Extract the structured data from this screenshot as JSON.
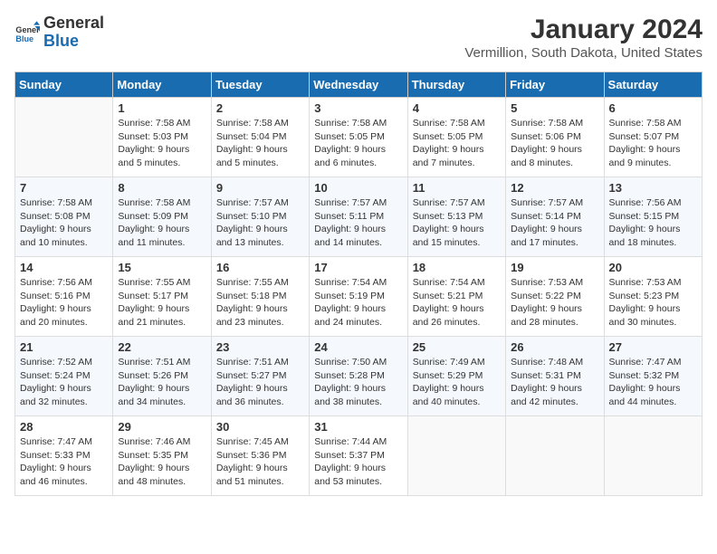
{
  "logo": {
    "general": "General",
    "blue": "Blue"
  },
  "title": "January 2024",
  "location": "Vermillion, South Dakota, United States",
  "days_of_week": [
    "Sunday",
    "Monday",
    "Tuesday",
    "Wednesday",
    "Thursday",
    "Friday",
    "Saturday"
  ],
  "weeks": [
    [
      {
        "day": "",
        "info": ""
      },
      {
        "day": "1",
        "info": "Sunrise: 7:58 AM\nSunset: 5:03 PM\nDaylight: 9 hours\nand 5 minutes."
      },
      {
        "day": "2",
        "info": "Sunrise: 7:58 AM\nSunset: 5:04 PM\nDaylight: 9 hours\nand 5 minutes."
      },
      {
        "day": "3",
        "info": "Sunrise: 7:58 AM\nSunset: 5:05 PM\nDaylight: 9 hours\nand 6 minutes."
      },
      {
        "day": "4",
        "info": "Sunrise: 7:58 AM\nSunset: 5:05 PM\nDaylight: 9 hours\nand 7 minutes."
      },
      {
        "day": "5",
        "info": "Sunrise: 7:58 AM\nSunset: 5:06 PM\nDaylight: 9 hours\nand 8 minutes."
      },
      {
        "day": "6",
        "info": "Sunrise: 7:58 AM\nSunset: 5:07 PM\nDaylight: 9 hours\nand 9 minutes."
      }
    ],
    [
      {
        "day": "7",
        "info": "Sunrise: 7:58 AM\nSunset: 5:08 PM\nDaylight: 9 hours\nand 10 minutes."
      },
      {
        "day": "8",
        "info": "Sunrise: 7:58 AM\nSunset: 5:09 PM\nDaylight: 9 hours\nand 11 minutes."
      },
      {
        "day": "9",
        "info": "Sunrise: 7:57 AM\nSunset: 5:10 PM\nDaylight: 9 hours\nand 13 minutes."
      },
      {
        "day": "10",
        "info": "Sunrise: 7:57 AM\nSunset: 5:11 PM\nDaylight: 9 hours\nand 14 minutes."
      },
      {
        "day": "11",
        "info": "Sunrise: 7:57 AM\nSunset: 5:13 PM\nDaylight: 9 hours\nand 15 minutes."
      },
      {
        "day": "12",
        "info": "Sunrise: 7:57 AM\nSunset: 5:14 PM\nDaylight: 9 hours\nand 17 minutes."
      },
      {
        "day": "13",
        "info": "Sunrise: 7:56 AM\nSunset: 5:15 PM\nDaylight: 9 hours\nand 18 minutes."
      }
    ],
    [
      {
        "day": "14",
        "info": "Sunrise: 7:56 AM\nSunset: 5:16 PM\nDaylight: 9 hours\nand 20 minutes."
      },
      {
        "day": "15",
        "info": "Sunrise: 7:55 AM\nSunset: 5:17 PM\nDaylight: 9 hours\nand 21 minutes."
      },
      {
        "day": "16",
        "info": "Sunrise: 7:55 AM\nSunset: 5:18 PM\nDaylight: 9 hours\nand 23 minutes."
      },
      {
        "day": "17",
        "info": "Sunrise: 7:54 AM\nSunset: 5:19 PM\nDaylight: 9 hours\nand 24 minutes."
      },
      {
        "day": "18",
        "info": "Sunrise: 7:54 AM\nSunset: 5:21 PM\nDaylight: 9 hours\nand 26 minutes."
      },
      {
        "day": "19",
        "info": "Sunrise: 7:53 AM\nSunset: 5:22 PM\nDaylight: 9 hours\nand 28 minutes."
      },
      {
        "day": "20",
        "info": "Sunrise: 7:53 AM\nSunset: 5:23 PM\nDaylight: 9 hours\nand 30 minutes."
      }
    ],
    [
      {
        "day": "21",
        "info": "Sunrise: 7:52 AM\nSunset: 5:24 PM\nDaylight: 9 hours\nand 32 minutes."
      },
      {
        "day": "22",
        "info": "Sunrise: 7:51 AM\nSunset: 5:26 PM\nDaylight: 9 hours\nand 34 minutes."
      },
      {
        "day": "23",
        "info": "Sunrise: 7:51 AM\nSunset: 5:27 PM\nDaylight: 9 hours\nand 36 minutes."
      },
      {
        "day": "24",
        "info": "Sunrise: 7:50 AM\nSunset: 5:28 PM\nDaylight: 9 hours\nand 38 minutes."
      },
      {
        "day": "25",
        "info": "Sunrise: 7:49 AM\nSunset: 5:29 PM\nDaylight: 9 hours\nand 40 minutes."
      },
      {
        "day": "26",
        "info": "Sunrise: 7:48 AM\nSunset: 5:31 PM\nDaylight: 9 hours\nand 42 minutes."
      },
      {
        "day": "27",
        "info": "Sunrise: 7:47 AM\nSunset: 5:32 PM\nDaylight: 9 hours\nand 44 minutes."
      }
    ],
    [
      {
        "day": "28",
        "info": "Sunrise: 7:47 AM\nSunset: 5:33 PM\nDaylight: 9 hours\nand 46 minutes."
      },
      {
        "day": "29",
        "info": "Sunrise: 7:46 AM\nSunset: 5:35 PM\nDaylight: 9 hours\nand 48 minutes."
      },
      {
        "day": "30",
        "info": "Sunrise: 7:45 AM\nSunset: 5:36 PM\nDaylight: 9 hours\nand 51 minutes."
      },
      {
        "day": "31",
        "info": "Sunrise: 7:44 AM\nSunset: 5:37 PM\nDaylight: 9 hours\nand 53 minutes."
      },
      {
        "day": "",
        "info": ""
      },
      {
        "day": "",
        "info": ""
      },
      {
        "day": "",
        "info": ""
      }
    ]
  ]
}
